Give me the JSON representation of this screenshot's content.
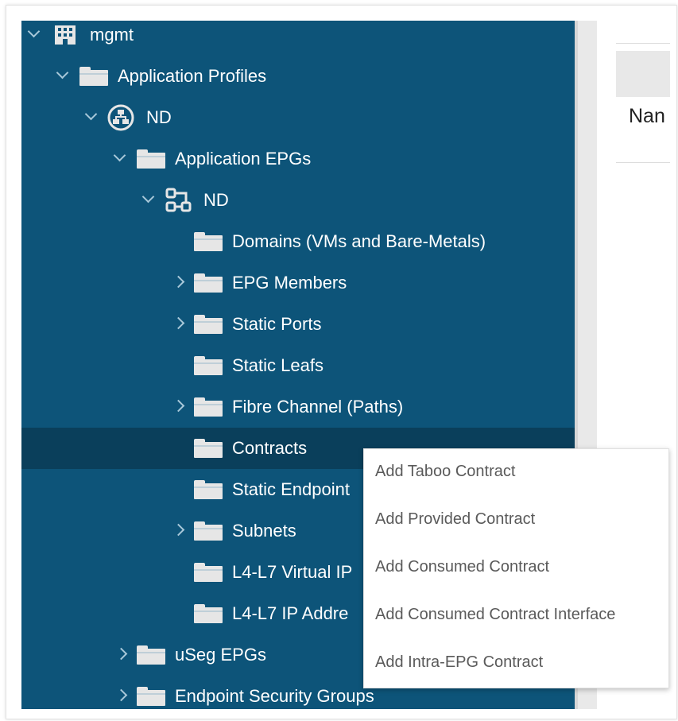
{
  "tree": {
    "root": "mgmt",
    "application_profiles": "Application Profiles",
    "ap_nd": "ND",
    "application_epgs": "Application EPGs",
    "epg_nd": "ND",
    "domains": "Domains (VMs and Bare-Metals)",
    "epg_members": "EPG Members",
    "static_ports": "Static Ports",
    "static_leafs": "Static Leafs",
    "fibre_channel": "Fibre Channel (Paths)",
    "contracts": "Contracts",
    "static_endpoint": "Static Endpoint",
    "subnets": "Subnets",
    "l4l7_virtual": "L4-L7 Virtual IP",
    "l4l7_ip": "L4-L7 IP Addre",
    "useg_epgs": "uSeg EPGs",
    "endpoint_security_groups": "Endpoint Security Groups"
  },
  "right_pane": {
    "column_header": "Nan"
  },
  "context_menu": {
    "items": [
      "Add Taboo Contract",
      "Add Provided Contract",
      "Add Consumed Contract",
      "Add Consumed Contract Interface",
      "Add Intra-EPG Contract"
    ]
  },
  "colors": {
    "tree_bg": "#0d5479",
    "tree_selected": "#0a3f5b",
    "menu_text": "#5a5a5a"
  }
}
